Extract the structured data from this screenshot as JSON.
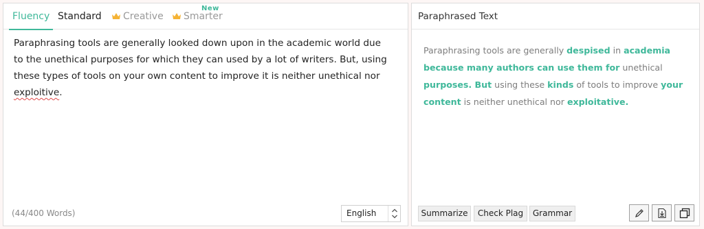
{
  "tabs": [
    {
      "label": "Fluency",
      "state": "active"
    },
    {
      "label": "Standard",
      "state": "normal"
    },
    {
      "label": "Creative",
      "state": "locked",
      "icon": "crown-icon"
    },
    {
      "label": "Smarter",
      "state": "locked",
      "icon": "crown-icon",
      "badge": "New"
    }
  ],
  "input": {
    "text_before": "Paraphrasing tools are generally looked down upon in the academic world due to the unethical purposes for which they can used by a lot of writers. But, using these types of tools on your own content to improve it is neither unethical nor ",
    "misspelled": "exploitive",
    "text_after": ".",
    "word_count": "(44/400 Words)",
    "language": "English"
  },
  "output": {
    "header": "Paraphrased Text",
    "segments": [
      {
        "text": "Paraphrasing tools are generally ",
        "changed": false
      },
      {
        "text": "despised",
        "changed": true
      },
      {
        "text": " in ",
        "changed": false
      },
      {
        "text": "academia because many authors can use them for",
        "changed": true
      },
      {
        "text": " unethical ",
        "changed": false
      },
      {
        "text": "purposes. But",
        "changed": true
      },
      {
        "text": " using these ",
        "changed": false
      },
      {
        "text": "kinds",
        "changed": true
      },
      {
        "text": " of tools to improve ",
        "changed": false
      },
      {
        "text": "your content",
        "changed": true
      },
      {
        "text": " is neither unethical nor ",
        "changed": false
      },
      {
        "text": "exploitative.",
        "changed": true
      }
    ]
  },
  "actions": {
    "summarize": "Summarize",
    "check_plag": "Check Plag",
    "grammar": "Grammar"
  },
  "icons": {
    "edit": "edit-icon",
    "download": "download-icon",
    "copy": "copy-icon"
  },
  "colors": {
    "accent": "#3fb89a",
    "crown": "#f5b335",
    "spellcheck": "#e04848"
  }
}
